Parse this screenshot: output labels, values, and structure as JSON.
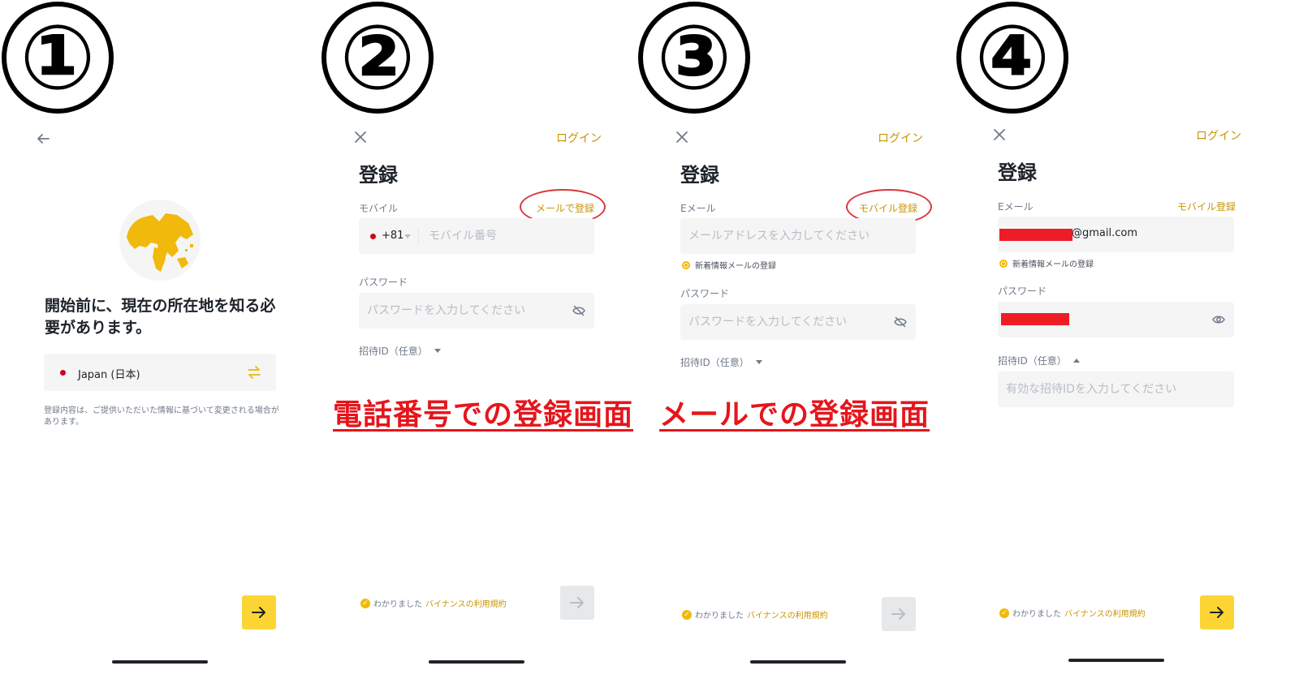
{
  "steps": [
    "①",
    "②",
    "③",
    "④"
  ],
  "panel1": {
    "heading": "開始前に、現在の所在地を知る必要があります。",
    "country_label": "Japan (日本)",
    "note": "登録内容は、ご提供いただいた情報に基づいて変更される場合があります。"
  },
  "panel2": {
    "login": "ログイン",
    "title": "登録",
    "mobile_label": "モバイル",
    "switch_link": "メールで登録",
    "country_code": "+81",
    "phone_placeholder": "モバイル番号",
    "password_label": "パスワード",
    "password_placeholder": "パスワードを入力してください",
    "invite_label": "招待ID（任意）",
    "agree_text": "わかりました",
    "terms_link": "バイナンスの利用規約",
    "caption": "電話番号での登録画面"
  },
  "panel3": {
    "login": "ログイン",
    "title": "登録",
    "email_label": "Eメール",
    "switch_link": "モバイル登録",
    "email_placeholder": "メールアドレスを入力してください",
    "newsletter": "新着情報メールの登録",
    "password_label": "パスワード",
    "password_placeholder": "パスワードを入力してください",
    "invite_label": "招待ID（任意）",
    "agree_text": "わかりました",
    "terms_link": "バイナンスの利用規約",
    "caption": "メールでの登録画面"
  },
  "panel4": {
    "login": "ログイン",
    "title": "登録",
    "email_label": "Eメール",
    "switch_link": "モバイル登録",
    "email_value": "@gmail.com",
    "newsletter": "新着情報メールの登録",
    "password_label": "パスワード",
    "invite_label": "招待ID（任意）",
    "invite_placeholder": "有効な招待IDを入力してください",
    "agree_text": "わかりました",
    "terms_link": "バイナンスの利用規約"
  },
  "colors": {
    "brand_yellow": "#fcd535",
    "link_gold": "#c99400",
    "caption_red": "#e6151b",
    "redaction_red": "#ee1c25"
  },
  "icons": [
    "back-arrow-icon",
    "close-icon",
    "globe-icon",
    "swap-icon",
    "eye-off-icon",
    "eye-icon",
    "arrow-right-icon",
    "check-circle-icon",
    "japan-flag-icon"
  ]
}
